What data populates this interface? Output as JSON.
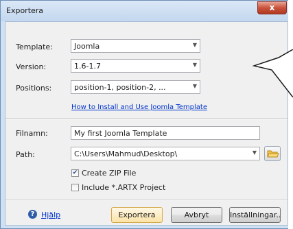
{
  "window": {
    "title": "Exportera",
    "close_glyph": "x"
  },
  "template_label": "Template:",
  "template_value": "Joomla",
  "version_label": "Version:",
  "version_value": "1.6-1.7",
  "positions_label": "Positions:",
  "positions_value": "position-1, position-2, ...",
  "howto_link": "How to Install and Use Joomla Template",
  "filename_label": "Filnamn:",
  "filename_value": "My first Joomla Template",
  "path_label": "Path:",
  "path_value": "C:\\Users\\Mahmud\\Desktop\\",
  "create_zip": {
    "label": "Create ZIP File",
    "checked": true
  },
  "include_artx": {
    "label": "Include *.ARTX Project",
    "checked": false
  },
  "help_link": "Hjälp",
  "buttons": {
    "export": "Exportera",
    "cancel": "Avbryt",
    "settings": "Inställningar..."
  },
  "icons": {
    "help": "help-circle-icon",
    "folder": "folder-icon",
    "dropdown": "chevron-down-icon"
  }
}
